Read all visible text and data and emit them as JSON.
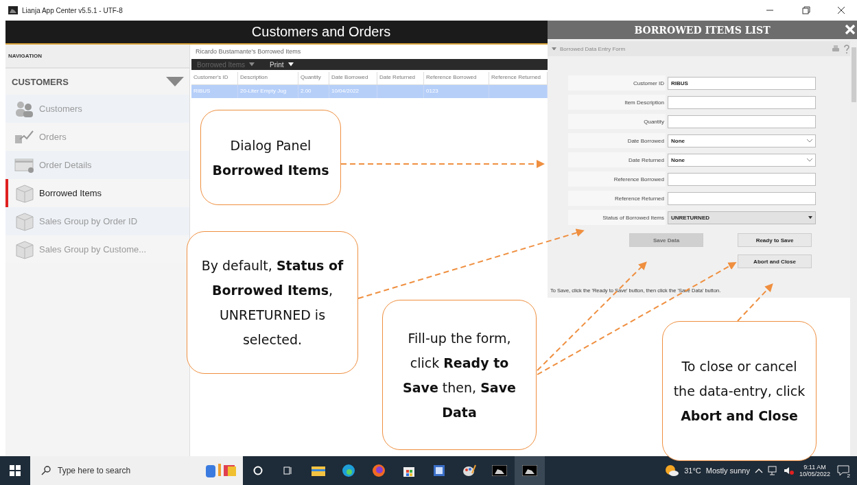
{
  "window": {
    "title": "Lianja App Center v5.5.1 - UTF-8"
  },
  "app_header": {
    "title": "Customers and Orders"
  },
  "navigation": {
    "heading": "NAVIGATION",
    "section": "CUSTOMERS",
    "expanded": true,
    "items": [
      {
        "label": "Customers",
        "selected": false
      },
      {
        "label": "Orders",
        "selected": false
      },
      {
        "label": "Order Details",
        "selected": false
      },
      {
        "label": "Borrowed Items",
        "selected": true
      },
      {
        "label": "Sales Group by Order ID",
        "selected": false
      },
      {
        "label": "Sales Group by Custome...",
        "selected": false
      }
    ]
  },
  "main": {
    "caption": "Ricardo Bustamante's Borrowed Items",
    "menus": [
      {
        "label": "Borrowed Items",
        "disabled": true
      },
      {
        "label": "Print",
        "disabled": false
      }
    ],
    "table": {
      "columns": [
        "Customer's ID",
        "Description",
        "Quantity",
        "Date Borrowed",
        "Date Returned",
        "Reference Borrowed",
        "Reference Returned"
      ],
      "rows": [
        {
          "selected": true,
          "cells": [
            "RIBUS",
            "20-Liter Empty Jug",
            "2.00",
            "10/04/2022",
            "",
            "0123",
            ""
          ]
        }
      ]
    }
  },
  "dialog": {
    "title": "BORROWED ITEMS LIST",
    "section": "Borrowed Data Entry Form",
    "fields": [
      {
        "label": "Customer ID",
        "kind": "text",
        "value": "RIBUS"
      },
      {
        "label": "Item Description",
        "kind": "text"
      },
      {
        "label": "Quantity",
        "kind": "text"
      },
      {
        "label": "Date Borrowed",
        "kind": "date",
        "value": "None"
      },
      {
        "label": "Date Returned",
        "kind": "date",
        "value": "None"
      },
      {
        "label": "Reference Borrowed",
        "kind": "text"
      },
      {
        "label": "Reference Returned",
        "kind": "text"
      },
      {
        "label": "Status of Borrowed Items",
        "kind": "select",
        "value": "UNRETURNED"
      }
    ],
    "buttons": [
      {
        "label": "Save Data",
        "disabled": true
      },
      {
        "label": "Ready to Save",
        "disabled": false
      },
      {
        "label": "Abort and Close",
        "disabled": false
      }
    ],
    "hint": "To Save, click the 'Ready to Save' button, then click the 'Save Data' button."
  },
  "callouts": [
    {
      "lines": [
        "Dialog Panel",
        "**Borrowed Items**"
      ]
    },
    {
      "lines": [
        "By default, **Status of Borrowed Items**, UNRETURNED is selected."
      ]
    },
    {
      "lines": [
        "Fill-up the form, click **Ready to Save** then, **Save Data**"
      ]
    },
    {
      "lines": [
        "To close or cancel the data-entry, click **Abort and Close**"
      ]
    }
  ],
  "taskbar": {
    "search_placeholder": "Type here to search",
    "temperature": "31°C",
    "weather": "Mostly sunny",
    "time": "9:11 AM",
    "date": "10/05/2022",
    "notifications": "2"
  }
}
